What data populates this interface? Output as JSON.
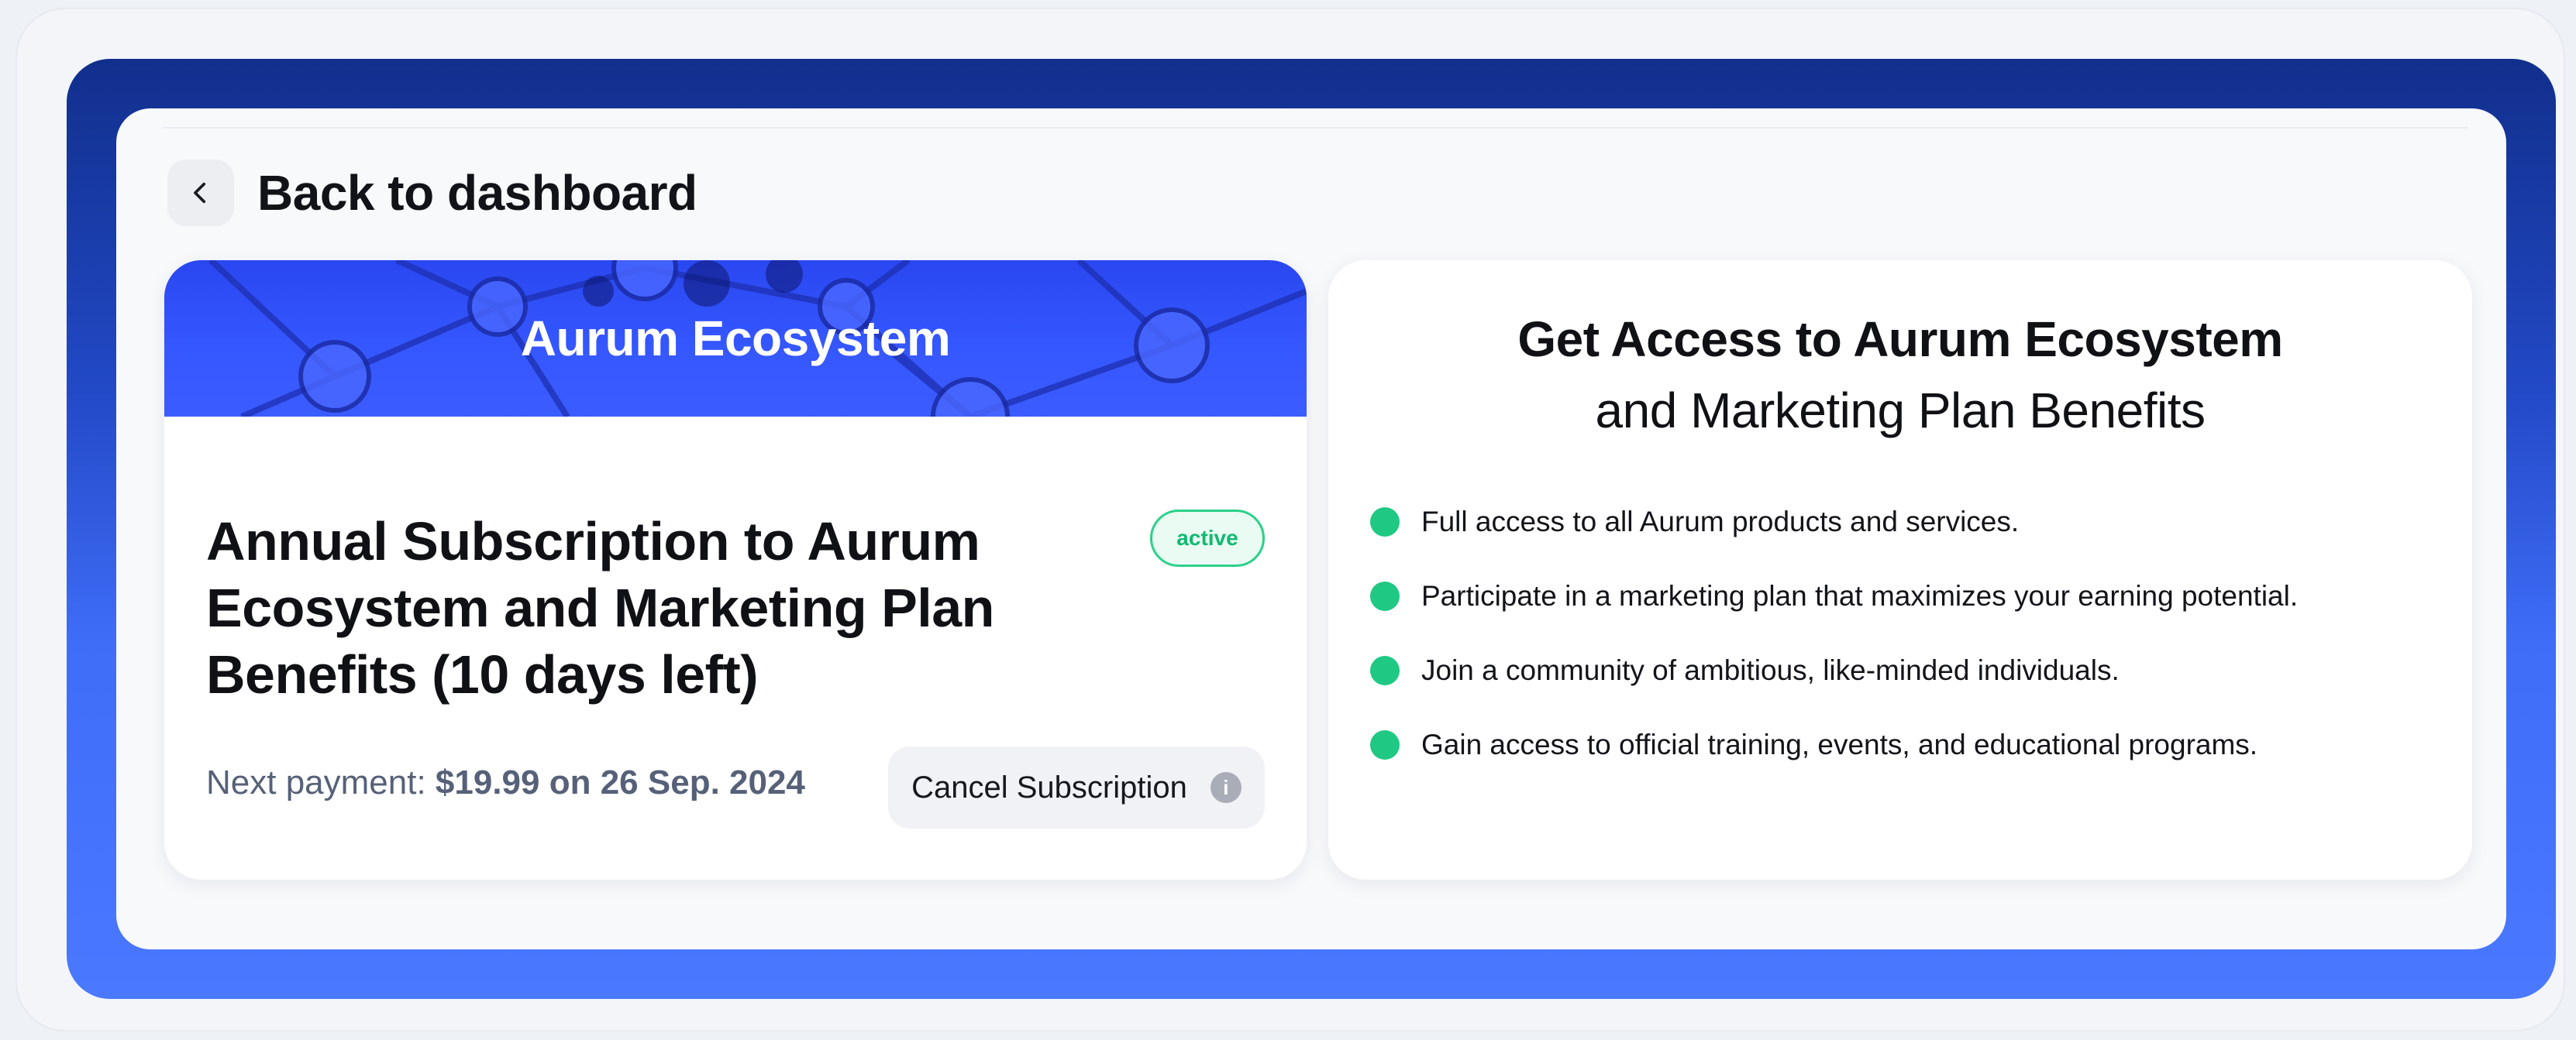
{
  "nav": {
    "back_label": "Back to dashboard"
  },
  "subscription": {
    "banner_title": "Aurum Ecosystem",
    "title": "Annual Subscription to Aurum Ecosystem and Marketing Plan Benefits (10 days left)",
    "status": "active",
    "next_payment_label": "Next payment:",
    "next_payment_value": "$19.99 on 26 Sep. 2024",
    "cancel_label": "Cancel Subscription"
  },
  "benefits": {
    "heading_line1": "Get Access to Aurum Ecosystem",
    "heading_line2": "and Marketing Plan Benefits",
    "items": [
      "Full access to all Aurum products and services.",
      "Participate in a marketing plan that maximizes your earning potential.",
      "Join a community of ambitious, like-minded individuals.",
      "Gain access to official training, events, and educational programs."
    ]
  },
  "icons": {
    "back": "chevron-left-icon",
    "info": "info-icon",
    "bullet": "bullet-dot-icon"
  },
  "colors": {
    "frame_top": "#112f8c",
    "frame_bottom": "#4a78ff",
    "banner": "#3557ff",
    "accent_green": "#1fc983"
  }
}
